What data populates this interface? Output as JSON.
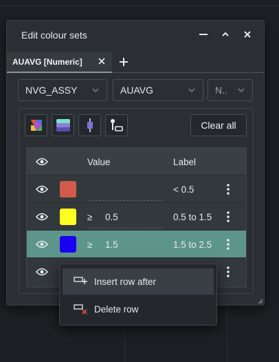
{
  "dialog": {
    "title": "Edit colour sets",
    "tab_label": "AUAVG [Numeric]"
  },
  "dropdowns": {
    "first": "NVG_ASSY",
    "second": "AUAVG",
    "third": "N.."
  },
  "toolbar": {
    "clear_all_label": "Clear all"
  },
  "table": {
    "headers": {
      "value": "Value",
      "label": "Label"
    },
    "rows": [
      {
        "color": "#cf5b48",
        "operator": "",
        "value": "",
        "label": "< 0.5"
      },
      {
        "color": "#ffff22",
        "operator": "≥",
        "value": "0.5",
        "label": "0.5 to 1.5"
      },
      {
        "color": "#1a00f2",
        "operator": "≥",
        "value": "1.5",
        "label": "1.5 to 2.5"
      },
      {
        "color": "",
        "operator": "",
        "value": "",
        "label": ""
      }
    ]
  },
  "context_menu": {
    "insert_label": "Insert row after",
    "delete_label": "Delete row"
  },
  "colors": {
    "selected_row": "#5e958a",
    "dialog_bg": "#2b2f34"
  }
}
